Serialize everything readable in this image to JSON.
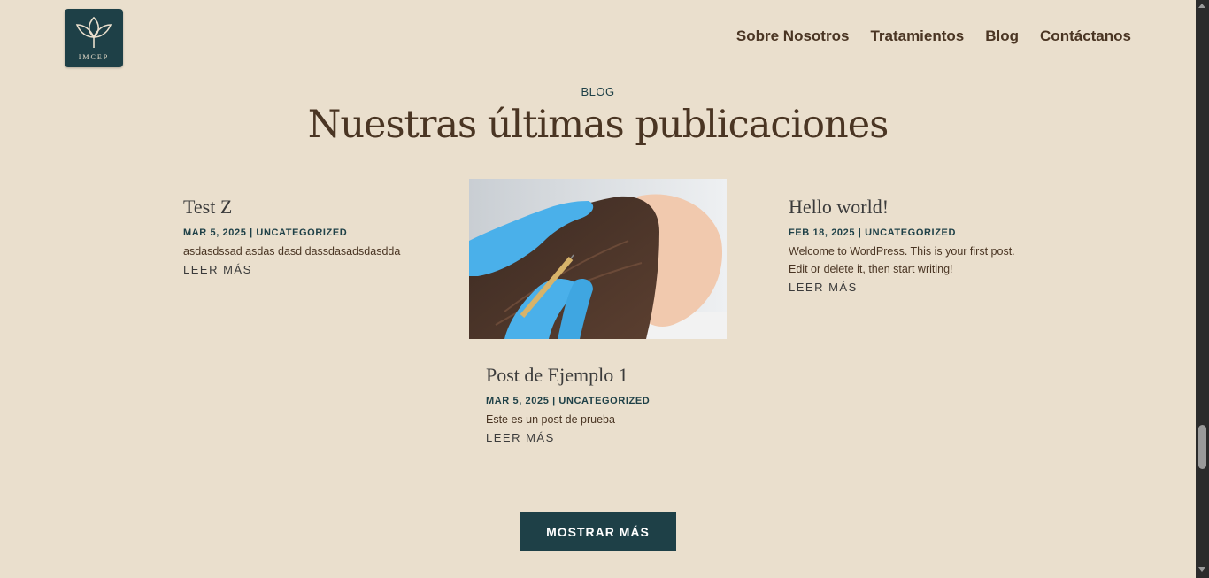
{
  "brand": {
    "logo_text": "IMCEP",
    "primary_color": "#1e4047",
    "background_color": "#eadfcd"
  },
  "nav": {
    "items": [
      "Sobre Nosotros",
      "Tratamientos",
      "Blog",
      "Contáctanos"
    ]
  },
  "section": {
    "eyebrow": "BLOG",
    "title": "Nuestras últimas publicaciones"
  },
  "posts": [
    {
      "title": "Test Z",
      "meta": "MAR 5, 2025 | UNCATEGORIZED",
      "excerpt": "asdasdssad asdas dasd dassdasadsdasdda",
      "more": "LEER MÁS"
    },
    {
      "title": "Post de Ejemplo 1",
      "meta": "MAR 5, 2025 | UNCATEGORIZED",
      "excerpt": "Este es un post de prueba",
      "more": "LEER MÁS",
      "image": "scalp-injection-treatment-photo"
    },
    {
      "title": "Hello world!",
      "meta": "FEB 18, 2025 | UNCATEGORIZED",
      "excerpt": "Welcome to WordPress. This is your first post. Edit or delete it, then start writing!",
      "more": "LEER MÁS"
    }
  ],
  "show_more": "MOSTRAR MÁS"
}
